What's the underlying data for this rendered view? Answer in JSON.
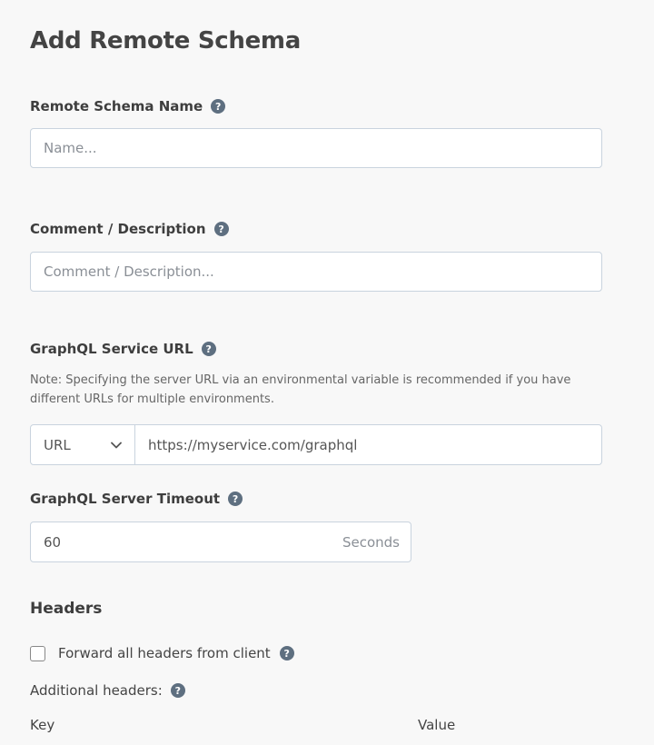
{
  "page": {
    "title": "Add Remote Schema"
  },
  "fields": {
    "name": {
      "label": "Remote Schema Name",
      "placeholder": "Name..."
    },
    "comment": {
      "label": "Comment / Description",
      "placeholder": "Comment / Description..."
    },
    "url": {
      "label": "GraphQL Service URL",
      "note": "Note: Specifying the server URL via an environmental variable is recommended if you have different URLs for multiple environments.",
      "type_selected": "URL",
      "value": "https://myservice.com/graphql"
    },
    "timeout": {
      "label": "GraphQL Server Timeout",
      "value": "60",
      "unit": "Seconds"
    }
  },
  "headers": {
    "heading": "Headers",
    "forward_label": "Forward all headers from client",
    "forward_checked": false,
    "additional_label": "Additional headers:",
    "key_column": "Key",
    "value_column": "Value"
  },
  "icons": {
    "help": "question-circle-icon",
    "dropdown": "chevron-down-icon"
  },
  "colors": {
    "background": "#f8f8f8",
    "input_border": "#c9d3de",
    "help_icon": "#5e6f80"
  }
}
